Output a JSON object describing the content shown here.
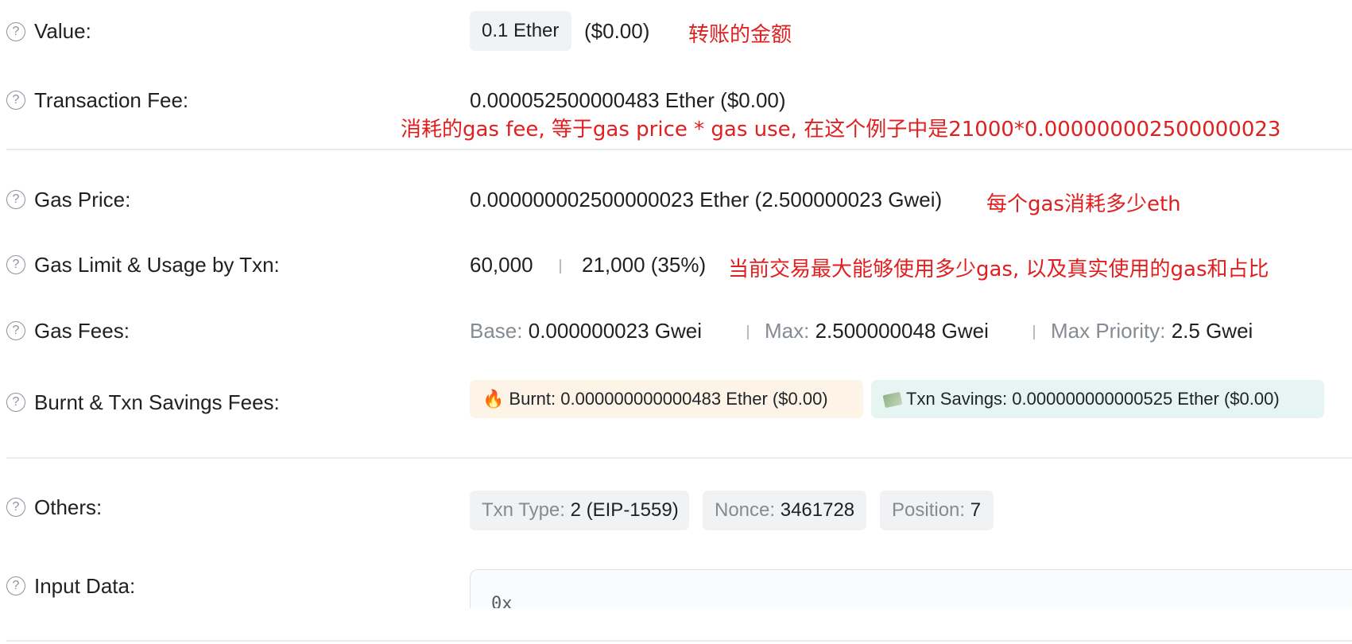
{
  "help_glyph": "?",
  "value": {
    "label": "Value:",
    "amount_chip": "0.1 Ether",
    "usd": "($0.00)",
    "note": "转账的金额"
  },
  "transaction_fee": {
    "label": "Transaction Fee:",
    "value": "0.000052500000483 Ether ($0.00)",
    "note": "消耗的gas fee, 等于gas price * gas use, 在这个例子中是21000*0.000000002500000023"
  },
  "gas_price": {
    "label": "Gas Price:",
    "value": "0.000000002500000023 Ether (2.500000023 Gwei)",
    "note": "每个gas消耗多少eth"
  },
  "gas_limit": {
    "label": "Gas Limit & Usage by Txn:",
    "limit": "60,000",
    "usage": "21,000 (35%)",
    "note": "当前交易最大能够使用多少gas, 以及真实使用的gas和占比"
  },
  "gas_fees": {
    "label": "Gas Fees:",
    "base_label": "Base:",
    "base_value": "0.000000023 Gwei",
    "max_label": "Max:",
    "max_value": "2.500000048 Gwei",
    "priority_label": "Max Priority:",
    "priority_value": "2.5 Gwei"
  },
  "burnt_savings": {
    "label": "Burnt & Txn Savings Fees:",
    "burnt_icon": "fire-icon",
    "burnt_label": "Burnt:",
    "burnt_value": "0.000000000000483 Ether ($0.00)",
    "savings_icon": "money-icon",
    "savings_label": "Txn Savings:",
    "savings_value": "0.000000000000525 Ether ($0.00)"
  },
  "others": {
    "label": "Others:",
    "txn_type_label": "Txn Type:",
    "txn_type_value": "2 (EIP-1559)",
    "nonce_label": "Nonce:",
    "nonce_value": "3461728",
    "position_label": "Position:",
    "position_value": "7"
  },
  "input_data": {
    "label": "Input Data:",
    "value": "0x"
  },
  "colors": {
    "annotation": "#e02020",
    "muted": "#858b92",
    "burnt_bg": "#fdf3e6",
    "savings_bg": "#e6f5f1",
    "chip_bg": "#f1f2f4"
  }
}
